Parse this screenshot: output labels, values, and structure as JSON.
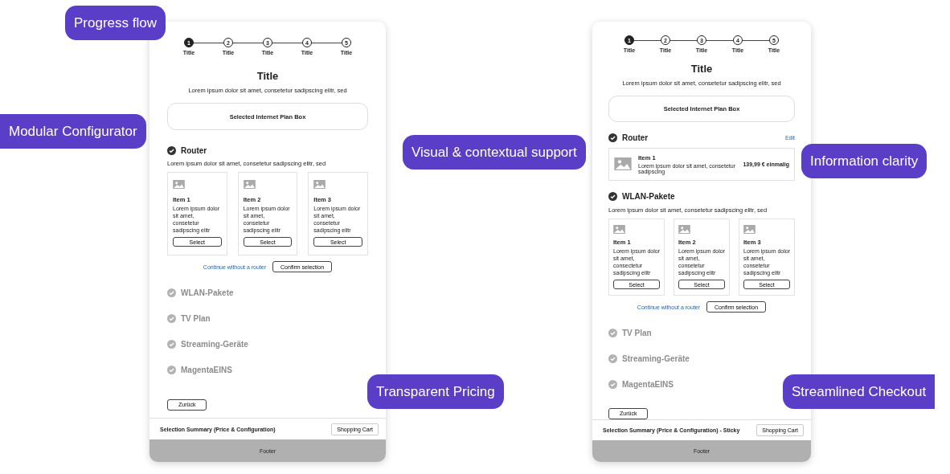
{
  "screens": [
    {
      "steps": [
        {
          "number": "1",
          "label": "Title",
          "selected": true
        },
        {
          "number": "2",
          "label": "Title",
          "selected": false
        },
        {
          "number": "3",
          "label": "Title",
          "selected": false
        },
        {
          "number": "4",
          "label": "Title",
          "selected": false
        },
        {
          "number": "5",
          "label": "Title",
          "selected": false
        }
      ],
      "title": "Title",
      "subtitle": "Lorem ipsum dolor sit amet, consetetur sadipscing elitr, sed",
      "plan_box": "Selected Internet Plan Box",
      "sections": [
        {
          "kind": "expanded",
          "title": "Router",
          "description": "Lorem ipsum dolor sit amet, consetetur sadipscing elitr, sed",
          "items": [
            {
              "title": "Item 1",
              "text": "Lorem ipsum dolor sit amet, consetetur sadipscing elitr",
              "button": "Select"
            },
            {
              "title": "Item 2",
              "text": "Lorem ipsum dolor sit amet, consetetur sadipscing elitr",
              "button": "Select"
            },
            {
              "title": "Item 3",
              "text": "Lorem ipsum dolor sit amet, consetetur sadipscing elitr",
              "button": "Select"
            }
          ],
          "skip_link": "Continue without a router",
          "confirm_button": "Confirm selection"
        },
        {
          "kind": "collapsed",
          "title": "WLAN-Pakete"
        },
        {
          "kind": "collapsed",
          "title": "TV Plan"
        },
        {
          "kind": "collapsed",
          "title": "Streaming-Geräte"
        },
        {
          "kind": "collapsed",
          "title": "MagentaEINS"
        }
      ],
      "back_button": "Zurück",
      "summary_bar": {
        "text": "Selection Summary (Price & Configuration)",
        "button": "Shopping Cart"
      },
      "footer": "Footer"
    },
    {
      "steps": [
        {
          "number": "1",
          "label": "Title",
          "selected": true
        },
        {
          "number": "2",
          "label": "Title",
          "selected": false
        },
        {
          "number": "3",
          "label": "Title",
          "selected": false
        },
        {
          "number": "4",
          "label": "Title",
          "selected": false
        },
        {
          "number": "5",
          "label": "Title",
          "selected": false
        }
      ],
      "title": "Title",
      "subtitle": "Lorem ipsum dolor sit amet, consetetur sadipscing elitr, sed",
      "plan_box": "Selected Internet Plan Box",
      "sections": [
        {
          "kind": "summary",
          "title": "Router",
          "edit": "Edit",
          "item": {
            "title": "Item 1",
            "text": "Lorem ipsum dolor sit amet, consetetur sadipscing",
            "price": "139,99 € einmalig"
          }
        },
        {
          "kind": "expanded",
          "title": "WLAN-Pakete",
          "description": "Lorem ipsum dolor sit amet, consetetur sadipscing elitr, sed",
          "items": [
            {
              "title": "Item 1",
              "text": "Lorem ipsum dolor sit amet, consectetur sadipscing elitr",
              "button": "Select"
            },
            {
              "title": "Item 2",
              "text": "Lorem ipsum dolor sit amet, consetetur sadipscing elitr",
              "button": "Select"
            },
            {
              "title": "Item 3",
              "text": "Lorem ipsum dolor sit amet, consetetur sadipscing elitr",
              "button": "Select"
            }
          ],
          "skip_link": "Continue without a router",
          "confirm_button": "Confirm selection"
        },
        {
          "kind": "collapsed",
          "title": "TV Plan"
        },
        {
          "kind": "collapsed",
          "title": "Streaming-Geräte"
        },
        {
          "kind": "collapsed",
          "title": "MagentaEINS"
        }
      ],
      "back_button": "Zurück",
      "summary_bar": {
        "text": "Selection Summary (Price & Configuration) - Sticky",
        "button": "Shopping Cart"
      },
      "footer": "Footer"
    }
  ],
  "callouts": [
    {
      "text": "Progress flow"
    },
    {
      "text": "Modular Configurator"
    },
    {
      "text": "Visual & contextual support"
    },
    {
      "text": "Information clarity"
    },
    {
      "text": "Transparent Pricing"
    },
    {
      "text": "Streamlined Checkout"
    }
  ]
}
